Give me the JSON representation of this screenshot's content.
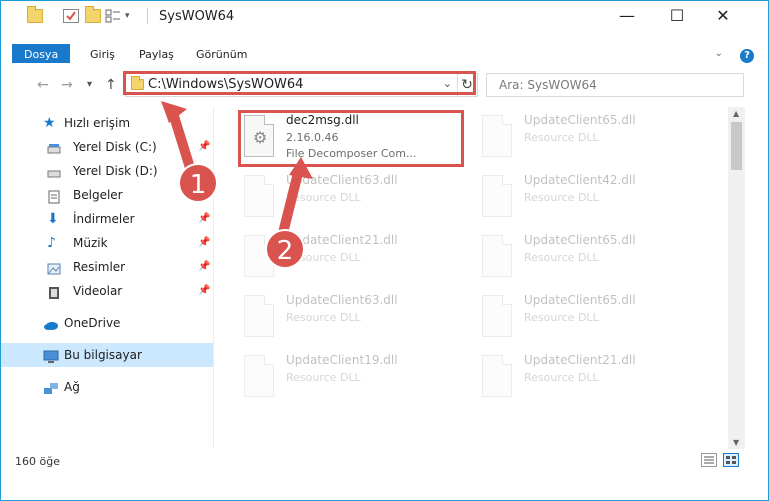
{
  "window": {
    "title": "SysWOW64",
    "minimize": "—",
    "maximize": "☐",
    "close": "✕"
  },
  "ribbon": {
    "tabs": [
      "Dosya",
      "Giriş",
      "Paylaş",
      "Görünüm"
    ],
    "help": "?"
  },
  "nav": {
    "back": "←",
    "forward": "→",
    "recent": "▾",
    "up": "↑",
    "address": "C:\\Windows\\SysWOW64",
    "refresh": "↻",
    "search_placeholder": "Ara: SysWOW64"
  },
  "sidebar": {
    "items": [
      {
        "label": "Hızlı erişim",
        "icon": "star-icon",
        "pinned": false
      },
      {
        "label": "Yerel Disk (C:)",
        "icon": "drive-icon",
        "pinned": true
      },
      {
        "label": "Yerel Disk (D:)",
        "icon": "drive-icon",
        "pinned": false
      },
      {
        "label": "Belgeler",
        "icon": "documents-icon",
        "pinned": false
      },
      {
        "label": "İndirmeler",
        "icon": "download-icon",
        "pinned": true
      },
      {
        "label": "Müzik",
        "icon": "music-icon",
        "pinned": true
      },
      {
        "label": "Resimler",
        "icon": "pictures-icon",
        "pinned": true
      },
      {
        "label": "Videolar",
        "icon": "videos-icon",
        "pinned": true
      },
      {
        "label": "OneDrive",
        "icon": "cloud-icon",
        "pinned": false
      },
      {
        "label": "Bu bilgisayar",
        "icon": "computer-icon",
        "pinned": false
      },
      {
        "label": "Ağ",
        "icon": "network-icon",
        "pinned": false
      }
    ]
  },
  "files": {
    "highlighted": {
      "name": "dec2msg.dll",
      "version": "2.16.0.46",
      "description": "File Decomposer Com..."
    },
    "faded": [
      {
        "name": "UpdateClient65.dll",
        "type": "Resource DLL"
      },
      {
        "name": "UpdateClient63.dll",
        "type": "Resource DLL"
      },
      {
        "name": "UpdateClient42.dll",
        "type": "Resource DLL"
      },
      {
        "name": "UpdateClient21.dll",
        "type": "Resource DLL"
      },
      {
        "name": "UpdateClient65.dll",
        "type": "Resource DLL"
      },
      {
        "name": "UpdateClient63.dll",
        "type": "Resource DLL"
      },
      {
        "name": "UpdateClient65.dll",
        "type": "Resource DLL"
      },
      {
        "name": "UpdateClient19.dll",
        "type": "Resource DLL"
      },
      {
        "name": "UpdateClient21.dll",
        "type": "Resource DLL"
      }
    ]
  },
  "status": {
    "count": "160 öğe"
  },
  "annotations": {
    "step1": "1",
    "step2": "2"
  },
  "colors": {
    "accent": "#1979ca",
    "highlight": "#d9534f",
    "selected": "#cce8ff"
  }
}
